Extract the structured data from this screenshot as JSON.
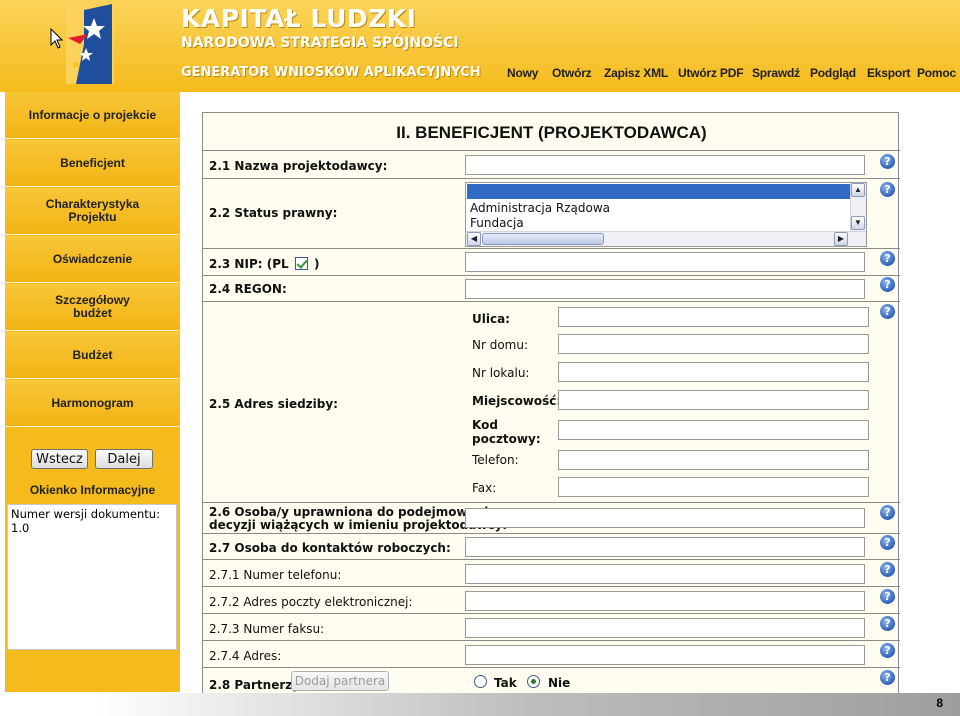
{
  "brand": {
    "title": "KAPITAŁ LUDZKI",
    "subtitle": "NARODOWA STRATEGIA SPÓJNOŚCI",
    "generator": "GENERATOR WNIOSKÓW APLIKACYJNYCH"
  },
  "topnav": [
    "Nowy",
    "Otwórz",
    "Zapisz XML",
    "Utwórz PDF",
    "Sprawdź",
    "Podgląd",
    "Eksport",
    "Pomoc"
  ],
  "sidebar": {
    "items": [
      "Informacje o projekcie",
      "Beneficjent",
      "Charakterystyka\nProjektu",
      "Oświadczenie",
      "Szczegółowy\nbudżet",
      "Budżet",
      "Harmonogram"
    ],
    "back_label": "Wstecz",
    "next_label": "Dalej",
    "info_title": "Okienko Informacyjne",
    "info_text": "Numer wersji dokumentu: 1.0"
  },
  "form": {
    "title": "II. BENEFICJENT (PROJEKTODAWCA)",
    "help_glyph": "?",
    "f21": "2.1 Nazwa projektodawcy:",
    "f22": "2.2 Status prawny:",
    "status_options": [
      "Administracja Rządowa",
      "Fundacja"
    ],
    "f23_prefix": "2.3 NIP: (PL",
    "f23_suffix": ")",
    "f24": "2.4 REGON:",
    "f25": "2.5 Adres siedziby:",
    "address": {
      "ulica": "Ulica:",
      "nr_domu": "Nr domu:",
      "nr_lokalu": "Nr lokalu:",
      "miejscowosc": "Miejscowość:",
      "kod_line1": "Kod",
      "kod_line2": "pocztowy:",
      "telefon": "Telefon:",
      "fax": "Fax:"
    },
    "f26_line1": "2.6 Osoba/y uprawniona do podejmowania",
    "f26_line2": "decyzji wiążących w imieniu projektodawcy:",
    "f27": "2.7 Osoba do kontaktów roboczych:",
    "f271": "2.7.1 Numer telefonu:",
    "f272": "2.7.2 Adres poczty elektronicznej:",
    "f273": "2.7.3 Numer faksu:",
    "f274": "2.7.4 Adres:",
    "f28": "2.8 Partnerzy:",
    "add_partner": "Dodaj partnera",
    "radio_yes": "Tak",
    "radio_no": "Nie",
    "partners_selected": "Nie"
  },
  "page_number": "8"
}
